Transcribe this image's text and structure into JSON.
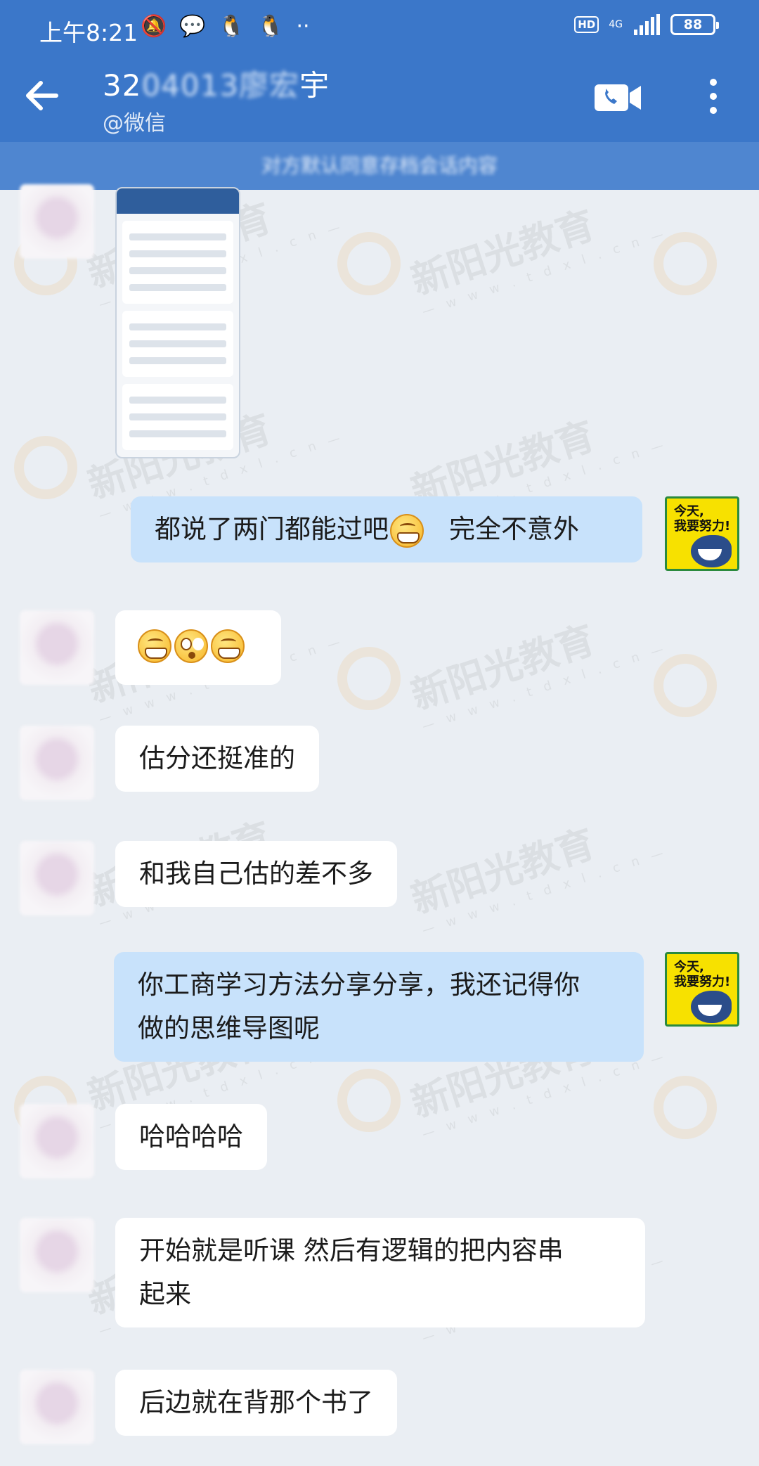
{
  "status_bar": {
    "time": "上午8:21",
    "dots": "··",
    "hd": "HD",
    "network": "4G",
    "battery": "88"
  },
  "header": {
    "title_prefix": "32",
    "title_hidden": "04013廖宏",
    "title_suffix": "宇",
    "subtitle": "@微信"
  },
  "notice": {
    "text": "对方默认同意存档会话内容"
  },
  "watermark": {
    "brand": "新阳光教育",
    "url": "— w w w . t d x l . c n —"
  },
  "avatar_me": {
    "line1": "今天,",
    "line2": "我要努力!"
  },
  "messages": [
    {
      "id": "m1",
      "side": "in",
      "kind": "image"
    },
    {
      "id": "m2",
      "side": "out",
      "text_a": "都说了两门都能过吧",
      "text_b": "完全不意外"
    },
    {
      "id": "m3",
      "side": "in",
      "kind": "emoji"
    },
    {
      "id": "m4",
      "side": "in",
      "text": "估分还挺准的"
    },
    {
      "id": "m5",
      "side": "in",
      "text": "和我自己估的差不多"
    },
    {
      "id": "m6",
      "side": "out",
      "line1": "你工商学习方法分享分享，我还记得你",
      "line2": "做的思维导图呢"
    },
    {
      "id": "m7",
      "side": "in",
      "text": "哈哈哈哈"
    },
    {
      "id": "m8",
      "side": "in",
      "line1": "开始就是听课 然后有逻辑的把内容串",
      "line2": "起来"
    },
    {
      "id": "m9",
      "side": "in",
      "text": "后边就在背那个书了"
    }
  ],
  "colors": {
    "header_bg": "#3b77c9",
    "notice_bg": "#4f86d0",
    "page_bg": "#eaeef3",
    "bubble_in": "#ffffff",
    "bubble_out": "#c8e2fb"
  }
}
